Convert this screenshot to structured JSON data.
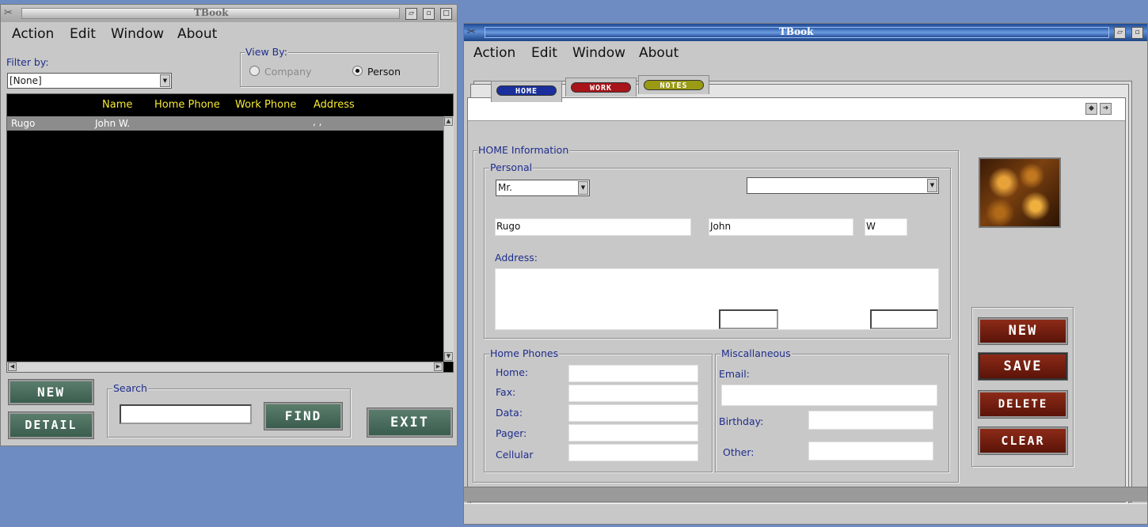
{
  "left_window": {
    "title": "TBook",
    "menu": [
      {
        "label": "Action"
      },
      {
        "label": "Edit"
      },
      {
        "label": "Window"
      },
      {
        "label": "About"
      }
    ],
    "filter_label": "Filter by:",
    "filter_value": "[None]",
    "view_by": {
      "title": "View By:",
      "company": "Company",
      "person": "Person",
      "selected": "Person"
    },
    "list": {
      "columns": [
        "Name",
        "Home Phone",
        "Work Phone",
        "Address"
      ],
      "rows": [
        {
          "last": "Rugo",
          "name": "John W.",
          "home_phone": "",
          "work_phone": "",
          "address": ", ,"
        }
      ]
    },
    "search": {
      "title": "Search",
      "value": ""
    },
    "buttons": {
      "new": "NEW",
      "detail": "DETAIL",
      "find": "FIND",
      "exit": "EXIT"
    }
  },
  "right_window": {
    "title": "TBook",
    "menu": [
      {
        "label": "Action"
      },
      {
        "label": "Edit"
      },
      {
        "label": "Window"
      },
      {
        "label": "About"
      }
    ],
    "tabs": [
      {
        "label": "HOME",
        "color": "#1a2f9c"
      },
      {
        "label": "WORK",
        "color": "#a8141a"
      },
      {
        "label": "NOTES",
        "color": "#9a9a14"
      }
    ],
    "home_info": {
      "title": "HOME Information",
      "personal": {
        "title": "Personal",
        "salutation": "Mr.",
        "suffix": "",
        "last_name": "Rugo",
        "first_name": "John",
        "middle": "W",
        "address_label": "Address:",
        "address_value": ""
      },
      "home_phones": {
        "title": "Home Phones",
        "home": "Home:",
        "fax": "Fax:",
        "data": "Data:",
        "pager": "Pager:",
        "cellular": "Cellular"
      },
      "misc": {
        "title": "Miscallaneous",
        "email": "Email:",
        "birthday": "Birthday:",
        "other": "Other:"
      }
    },
    "buttons": {
      "new": "NEW",
      "save": "SAVE",
      "delete": "DELETE",
      "clear": "CLEAR"
    }
  },
  "colors": {
    "desktop": "#6f8cc2",
    "window": "#c8c8c8",
    "list_bg": "#000000",
    "list_header": "#f5ea35",
    "label_blue": "#1e2d8c"
  }
}
